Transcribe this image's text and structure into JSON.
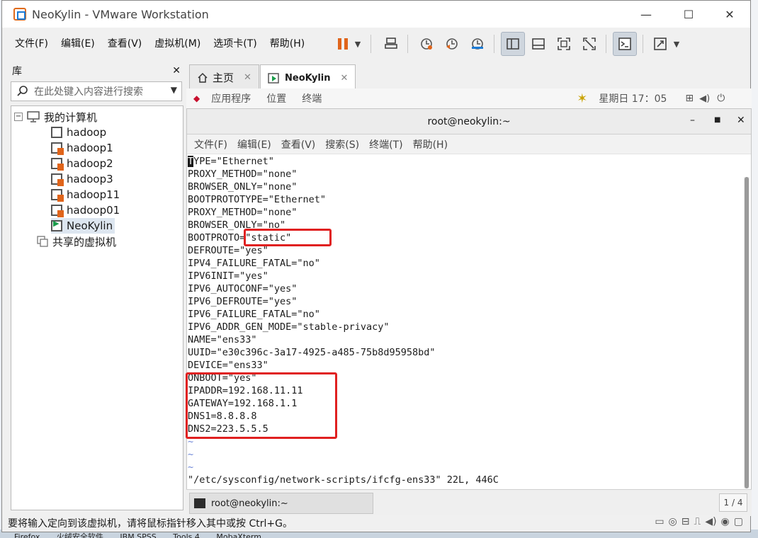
{
  "window": {
    "title": "NeoKylin - VMware Workstation",
    "minimize": "—",
    "maximize": "☐",
    "close": "✕"
  },
  "menubar": {
    "items": [
      "文件(F)",
      "编辑(E)",
      "查看(V)",
      "虚拟机(M)",
      "选项卡(T)",
      "帮助(H)"
    ]
  },
  "library": {
    "title": "库",
    "close": "✕",
    "search_placeholder": "在此处键入内容进行搜索",
    "root": "我的计算机",
    "vms": [
      "hadoop",
      "hadoop1",
      "hadoop2",
      "hadoop3",
      "hadoop11",
      "hadoop01",
      "NeoKylin"
    ],
    "shared": "共享的虚拟机"
  },
  "tabs": {
    "home": "主页",
    "vm": "NeoKylin"
  },
  "guest_topbar": {
    "apps": "应用程序",
    "places": "位置",
    "terminal": "终端",
    "clock": "星期日 17：05"
  },
  "terminal": {
    "title": "root@neokylin:~",
    "menu": [
      "文件(F)",
      "编辑(E)",
      "查看(V)",
      "搜索(S)",
      "终端(T)",
      "帮助(H)"
    ],
    "lines": [
      "YPE=\"Ethernet\"",
      "PROXY_METHOD=\"none\"",
      "BROWSER_ONLY=\"none\"",
      "BOOTPROTOTYPE=\"Ethernet\"",
      "PROXY_METHOD=\"none\"",
      "BROWSER_ONLY=\"no\"",
      "BOOTPROTO=\"static\"",
      "DEFROUTE=\"yes\"",
      "IPV4_FAILURE_FATAL=\"no\"",
      "IPV6INIT=\"yes\"",
      "IPV6_AUTOCONF=\"yes\"",
      "IPV6_DEFROUTE=\"yes\"",
      "IPV6_FAILURE_FATAL=\"no\"",
      "IPV6_ADDR_GEN_MODE=\"stable-privacy\"",
      "NAME=\"ens33\"",
      "UUID=\"e30c396c-3a17-4925-a485-75b8d95958bd\"",
      "DEVICE=\"ens33\"",
      "ONBOOT=\"yes\"",
      "IPADDR=192.168.11.11",
      "GATEWAY=192.168.1.1",
      "DNS1=8.8.8.8",
      "DNS2=223.5.5.5",
      "~",
      "~",
      "~",
      "\"/etc/sysconfig/network-scripts/ifcfg-ens33\" 22L, 446C"
    ],
    "cursor_char": "T"
  },
  "guest_taskbar": {
    "task": "root@neokylin:~",
    "page": "1 / 4"
  },
  "statusbar": {
    "text": "要将输入定向到该虚拟机，请将鼠标指针移入其中或按 Ctrl+G。"
  },
  "background": {
    "taskbar_items": [
      "Firefox",
      "火绒安全软件",
      "IBM SPSS",
      "Tools 4",
      "MobaXterm"
    ]
  }
}
